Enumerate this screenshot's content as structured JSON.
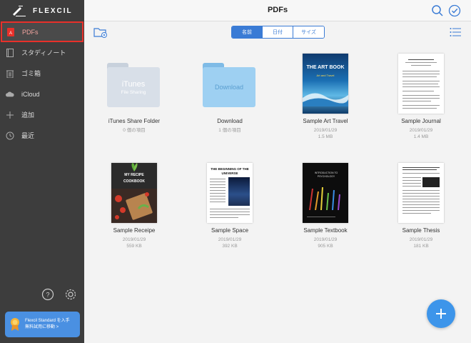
{
  "app": {
    "logo_text": "FLEXCIL"
  },
  "sidebar": {
    "items": [
      {
        "label": "PDFs",
        "icon": "pdf-icon"
      },
      {
        "label": "スタディノート",
        "icon": "notebook-icon"
      },
      {
        "label": "ゴミ箱",
        "icon": "trash-icon"
      },
      {
        "label": "iCloud",
        "icon": "cloud-icon"
      },
      {
        "label": "追加",
        "icon": "plus-icon"
      },
      {
        "label": "最近",
        "icon": "clock-icon"
      }
    ],
    "promo": {
      "line1": "Flexcil Standard を入手",
      "line2": "無料試用に移動 >"
    }
  },
  "header": {
    "title": "PDFs"
  },
  "toolbar": {
    "sort_options": [
      "名前",
      "日付",
      "サイズ"
    ],
    "selected": "名前"
  },
  "files": [
    {
      "name": "iTunes Share Folder",
      "meta1": "0 個の項目",
      "meta2": "",
      "kind": "folder",
      "folder_label": "iTunes",
      "folder_sub": "File Sharing"
    },
    {
      "name": "Download",
      "meta1": "1 個の項目",
      "meta2": "",
      "kind": "folder",
      "folder_label": "Download",
      "folder_sub": ""
    },
    {
      "name": "Sample Art Travel",
      "meta1": "2019/01/29",
      "meta2": "1.5 MB",
      "kind": "pdf",
      "cover_title": "THE ART BOOK",
      "cover_sub": "Art and Travel"
    },
    {
      "name": "Sample Journal",
      "meta1": "2019/01/29",
      "meta2": "1.4 MB",
      "kind": "pdf"
    },
    {
      "name": "Sample Receipe",
      "meta1": "2019/01/29",
      "meta2": "559 KB",
      "kind": "pdf",
      "cover_title": "MY RECIPE",
      "cover_sub": "COOKBOOK"
    },
    {
      "name": "Sample Space",
      "meta1": "2019/01/29",
      "meta2": "392 KB",
      "kind": "pdf",
      "cover_title": "THE BEGINNING OF THE UNIVERSE"
    },
    {
      "name": "Sample Textbook",
      "meta1": "2019/01/29",
      "meta2": "905 KB",
      "kind": "pdf",
      "cover_title": "INTRODUCTION TO PSYCHOLOGY"
    },
    {
      "name": "Sample Thesis",
      "meta1": "2019/01/29",
      "meta2": "181 KB",
      "kind": "pdf"
    }
  ],
  "colors": {
    "sidebar_bg": "#3d3d3d",
    "accent": "#3a7bd5",
    "highlight": "#e8302a",
    "fab": "#3d95ea"
  }
}
